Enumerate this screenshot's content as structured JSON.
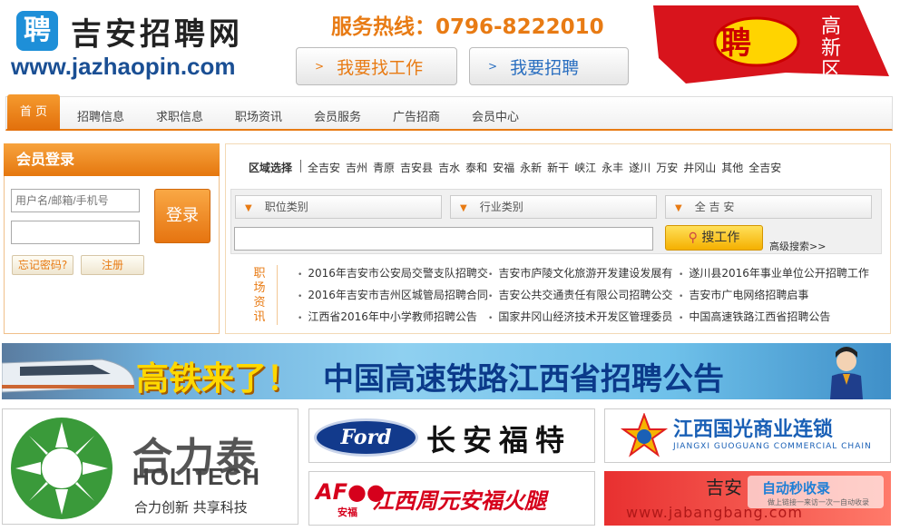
{
  "header": {
    "logo_char": "聘",
    "logo_cn": "吉安招聘网",
    "logo_url": "www.jazhaopin.com",
    "hotline": "服务热线：0796-8222010",
    "btn_find_job": "我要找工作",
    "btn_recruit": "我要招聘",
    "banner_char": "聘",
    "banner_small": "高新区"
  },
  "nav": {
    "items": [
      "首 页",
      "招聘信息",
      "求职信息",
      "职场资讯",
      "会员服务",
      "广告招商",
      "会员中心"
    ]
  },
  "login": {
    "title": "会员登录",
    "username_placeholder": "用户名/邮箱/手机号",
    "login_button": "登录",
    "forgot": "忘记密码?",
    "register": "注册"
  },
  "region": {
    "label": "区域选择",
    "items": [
      "全吉安",
      "吉州",
      "青原",
      "吉安县",
      "吉水",
      "泰和",
      "安福",
      "永新",
      "新干",
      "峡江",
      "永丰",
      "遂川",
      "万安",
      "井冈山",
      "其他",
      "全吉安"
    ]
  },
  "search": {
    "position_category": "职位类别",
    "industry_category": "行业类别",
    "area": "全 吉 安",
    "search_button": "搜工作",
    "advanced": "高级搜索>>"
  },
  "news": {
    "label": "职场资讯",
    "items": [
      "2016年吉安市公安局交警支队招聘交",
      "吉安市庐陵文化旅游开发建设发展有",
      "遂川县2016年事业单位公开招聘工作",
      "2016年吉安市吉州区城管局招聘合同",
      "吉安公共交通责任有限公司招聘公交",
      "吉安市广电网络招聘启事",
      "江西省2016年中小学教师招聘公告",
      "国家井冈山经济技术开发区管理委员",
      "中国高速铁路江西省招聘公告"
    ]
  },
  "ads": {
    "train_text1": "高铁来了！",
    "train_text2": "中国高速铁路江西省招聘公告",
    "holitech_cn": "合力泰",
    "holitech_en": "HOLITECH",
    "holitech_slogan": "合力创新 共享科技",
    "ford_logo": "Ford",
    "ford_cn": "长安福特",
    "guoguang_cn": "江西国光商业连锁",
    "guoguang_en": "JIANGXI GUOGUANG COMMERCIAL CHAIN",
    "anfu_logo": "安福",
    "anfu_cn": "江西周元安福火腿",
    "last_cn": "吉安",
    "last_url": "www.jabangbang.com",
    "watermark": "自动秒收录",
    "watermark_sub": "做上链接一来访一次一自动收录"
  },
  "colors": {
    "accent": "#e87b14",
    "brand_blue": "#1a4f94",
    "link_blue": "#2a6fc0"
  }
}
